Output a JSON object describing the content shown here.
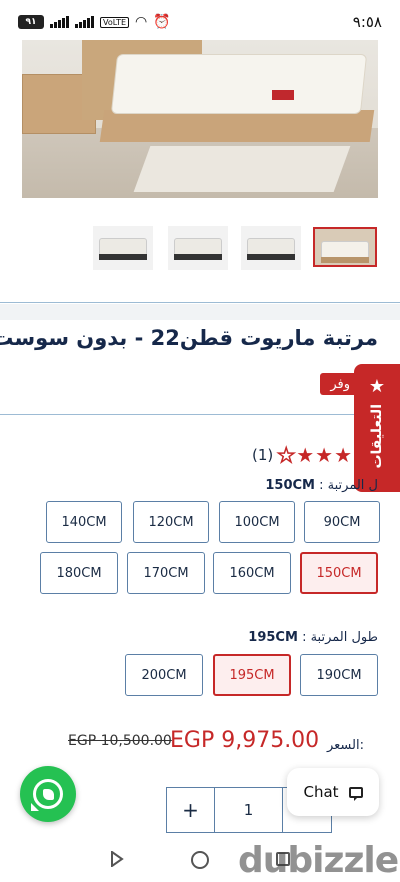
{
  "status_bar": {
    "battery": "٩١",
    "network": "VoLTE",
    "time": "٩:٥٨"
  },
  "product": {
    "title": "مرتبة ماريوت قطن22 - بدون سوست",
    "save_badge": "وفر",
    "comments_tab": "التعليقات",
    "rating_count": "(1)",
    "rating_value": 4,
    "rating_max": 5
  },
  "width_option": {
    "label": "ل المرتبة :",
    "selected": "150CM",
    "options": [
      "90CM",
      "100CM",
      "120CM",
      "140CM",
      "150CM",
      "160CM",
      "170CM",
      "180CM"
    ]
  },
  "length_option": {
    "label": "طول المرتبة :",
    "selected": "195CM",
    "options": [
      "190CM",
      "195CM",
      "200CM"
    ]
  },
  "price": {
    "label": "السعر:",
    "current": "EGP 9,975.00",
    "old": "EGP 10,500.00"
  },
  "quantity": {
    "plus": "+",
    "value": "1"
  },
  "chat": {
    "label": "Chat"
  },
  "watermark": "dubizzle",
  "colors": {
    "accent": "#c62828",
    "text": "#16284a",
    "border": "#5b7fa6",
    "whatsapp": "#25c152"
  }
}
